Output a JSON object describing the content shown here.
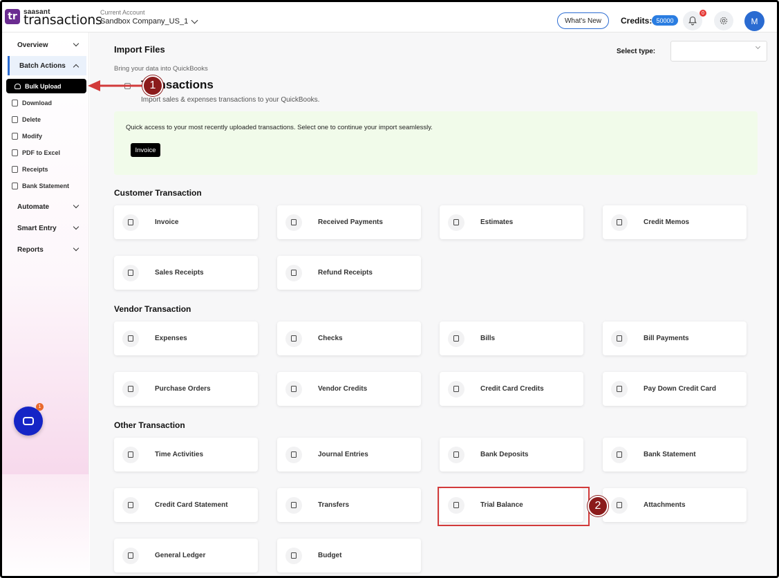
{
  "header": {
    "logo_text": "tr",
    "brand_small": "saasant",
    "brand_big": "transactions",
    "account_label": "Current Account",
    "account_name": "Sandbox Company_US_1",
    "whats_new": "What's New",
    "credits_label": "Credits:",
    "credits_value": "50000",
    "notification_count": "0",
    "avatar_initial": "M"
  },
  "sidebar": {
    "overview": "Overview",
    "batch_actions": "Batch Actions",
    "bulk_upload": "Bulk Upload",
    "download": "Download",
    "delete": "Delete",
    "modify": "Modify",
    "pdf_to_excel": "PDF to Excel",
    "receipts": "Receipts",
    "bank_statement": "Bank Statement",
    "automate": "Automate",
    "smart_entry": "Smart Entry",
    "reports": "Reports",
    "chat_badge": "1"
  },
  "main": {
    "import_title": "Import Files",
    "import_subtitle": "Bring your data into QuickBooks",
    "select_type_label": "Select type:",
    "tx_title": "Transactions",
    "tx_subtitle": "Import sales & expenses transactions to your QuickBooks.",
    "quick_text": "Quick access to your most recently uploaded transactions. Select one to continue your import seamlessly.",
    "quick_button": "Invoice",
    "sections": {
      "customer": "Customer Transaction",
      "vendor": "Vendor Transaction",
      "other": "Other Transaction"
    },
    "customer_items": [
      "Invoice",
      "Received Payments",
      "Estimates",
      "Credit Memos",
      "Sales Receipts",
      "Refund Receipts"
    ],
    "vendor_items": [
      "Expenses",
      "Checks",
      "Bills",
      "Bill Payments",
      "Purchase Orders",
      "Vendor Credits",
      "Credit Card Credits",
      "Pay Down Credit Card"
    ],
    "other_items": [
      "Time Activities",
      "Journal Entries",
      "Bank Deposits",
      "Bank Statement",
      "Credit Card Statement",
      "Transfers",
      "Trial Balance",
      "Attachments",
      "General Ledger",
      "Budget"
    ]
  },
  "annotations": {
    "step1": "1",
    "step2": "2",
    "color": "#d23a3a"
  }
}
